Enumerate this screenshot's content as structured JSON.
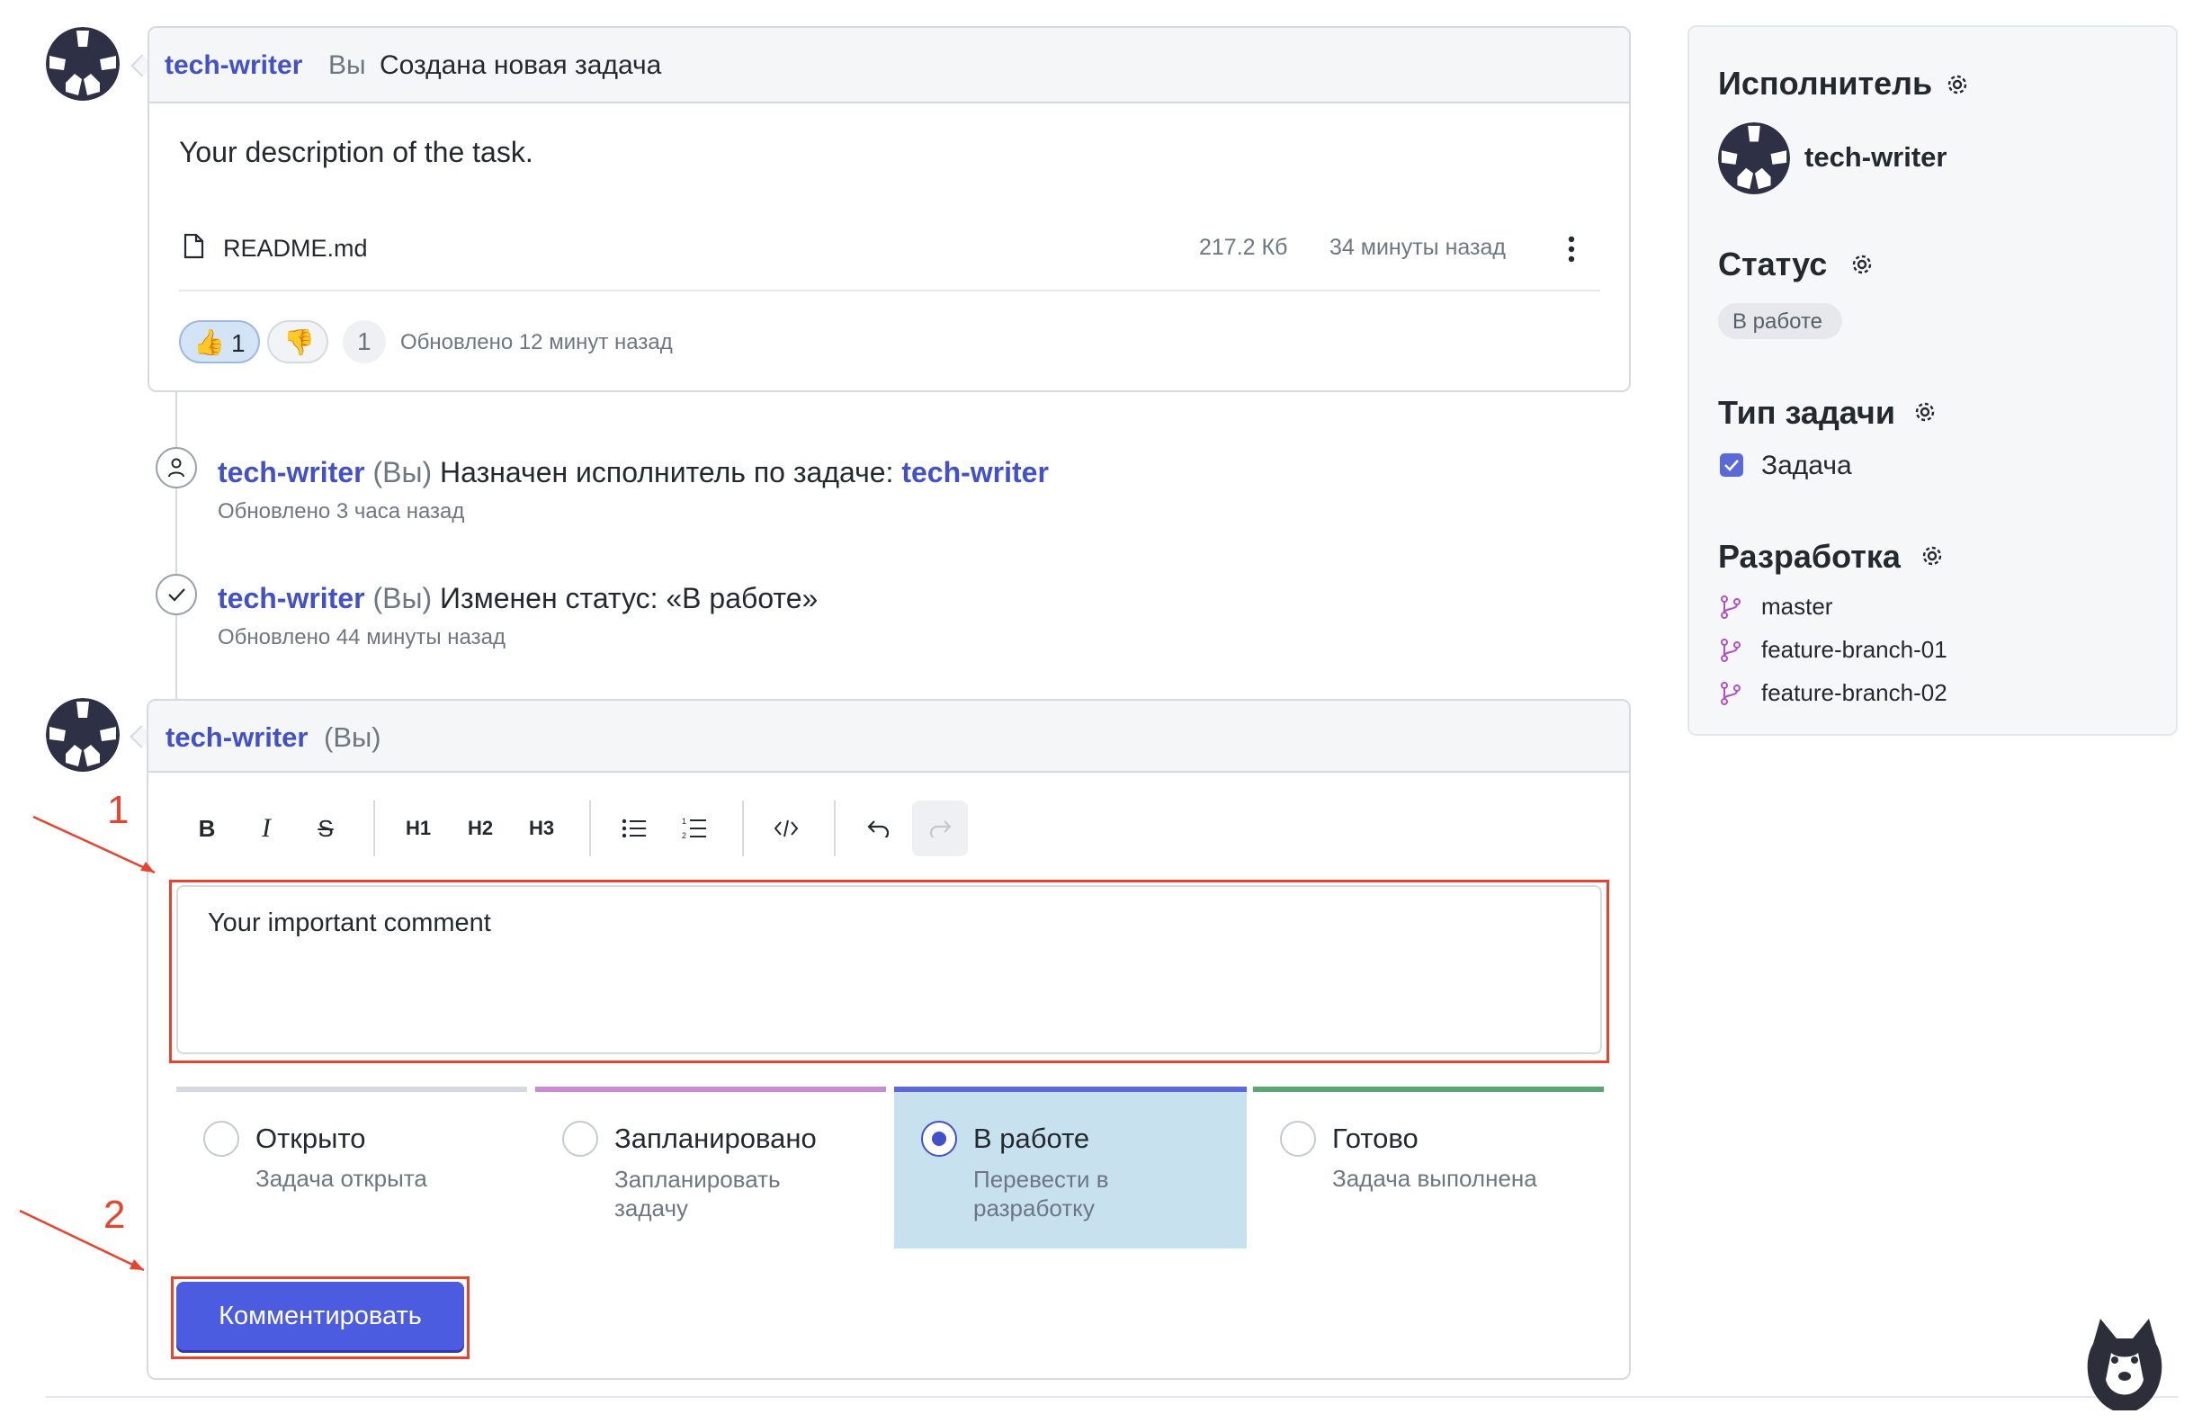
{
  "post": {
    "author": "tech-writer",
    "author_suffix": "Вы",
    "action": "Создана новая задача",
    "description": "Your description of the task.",
    "attachment": {
      "name": "README.md",
      "size": "217.2 Кб",
      "time": "34 минуты назад"
    },
    "reactions": {
      "thumbs_up_count": "1",
      "count_badge": "1"
    },
    "updated": "Обновлено 12 минут назад"
  },
  "timeline": [
    {
      "author": "tech-writer",
      "you": "(Вы)",
      "text": "Назначен исполнитель по задаче:",
      "target": "tech-writer",
      "updated": "Обновлено 3 часа назад",
      "icon": "user-icon"
    },
    {
      "author": "tech-writer",
      "you": "(Вы)",
      "text": "Изменен статус: «В работе»",
      "updated": "Обновлено 44 минуты назад",
      "icon": "check-icon"
    }
  ],
  "editor": {
    "author": "tech-writer",
    "you": "(Вы)",
    "toolbar": {
      "bold": "B",
      "italic": "I",
      "strike": "S",
      "h1": "H1",
      "h2": "H2",
      "h3": "H3"
    },
    "comment_value": "Your important comment",
    "statuses": [
      {
        "label": "Открыто",
        "hint": "Задача открыта",
        "color": "#d6dae0",
        "selected": false
      },
      {
        "label": "Запланировано",
        "hint": "Запланировать задачу",
        "color": "#c98bd1",
        "selected": false
      },
      {
        "label": "В работе",
        "hint": "Перевести в разработку",
        "color": "#5b6ad6",
        "selected": true
      },
      {
        "label": "Готово",
        "hint": "Задача выполнена",
        "color": "#5ba674",
        "selected": false
      }
    ],
    "submit_label": "Комментировать"
  },
  "annotations": {
    "marker_1": "1",
    "marker_2": "2",
    "color": "#e8432e"
  },
  "sidebar": {
    "assignee_title": "Исполнитель",
    "assignee_name": "tech-writer",
    "status_title": "Статус",
    "status_value": "В работе",
    "type_title": "Тип задачи",
    "type_value": "Задача",
    "dev_title": "Разработка",
    "branches": [
      "master",
      "feature-branch-01",
      "feature-branch-02"
    ]
  },
  "colors": {
    "accent": "#4250c9",
    "button": "#4c5ce0",
    "selected_status_bg": "#c8e1ef",
    "branch_icon": "#b34fc9"
  }
}
